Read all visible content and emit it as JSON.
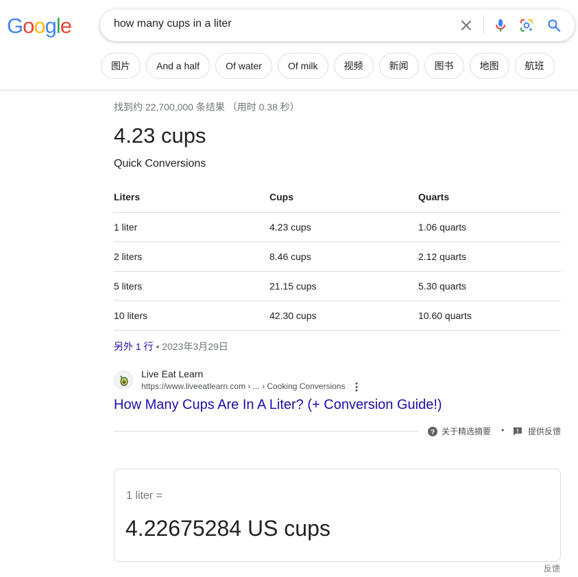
{
  "header": {
    "logo": "Google",
    "query": "how many cups in a liter",
    "icons": {
      "clear": "close-icon",
      "mic": "mic-icon",
      "lens": "lens-icon",
      "search": "search-icon"
    },
    "colors": {
      "blue": "#4285F4",
      "red": "#EA4335",
      "yellow": "#FBBC05",
      "green": "#34A853"
    }
  },
  "chips": [
    "图片",
    "And a half",
    "Of water",
    "Of milk",
    "视频",
    "新闻",
    "图书",
    "地图",
    "航班"
  ],
  "result_stats": "找到约 22,700,000 条结果 （用时 0.38 秒）",
  "snippet": {
    "answer": "4.23 cups",
    "subheading": "Quick Conversions",
    "table": {
      "headers": [
        "Liters",
        "Cups",
        "Quarts"
      ],
      "rows": [
        [
          "1 liter",
          "4.23 cups",
          "1.06 quarts"
        ],
        [
          "2 liters",
          "8.46 cups",
          "2.12 quarts"
        ],
        [
          "5 liters",
          "21.15 cups",
          "5.30 quarts"
        ],
        [
          "10 liters",
          "42.30 cups",
          "10.60 quarts"
        ]
      ]
    },
    "more_rows": "另外 1 行",
    "date": "2023年3月29日",
    "source": {
      "site_name": "Live Eat Learn",
      "url": "https://www.liveeatlearn.com › ... › Cooking Conversions",
      "title": "How Many Cups Are In A Liter? (+ Conversion Guide!)"
    },
    "about": "关于精选摘要",
    "feedback": "提供反馈"
  },
  "converter": {
    "from": "1 liter =",
    "to": "4.22675284 US cups",
    "feedback": "反馈"
  }
}
